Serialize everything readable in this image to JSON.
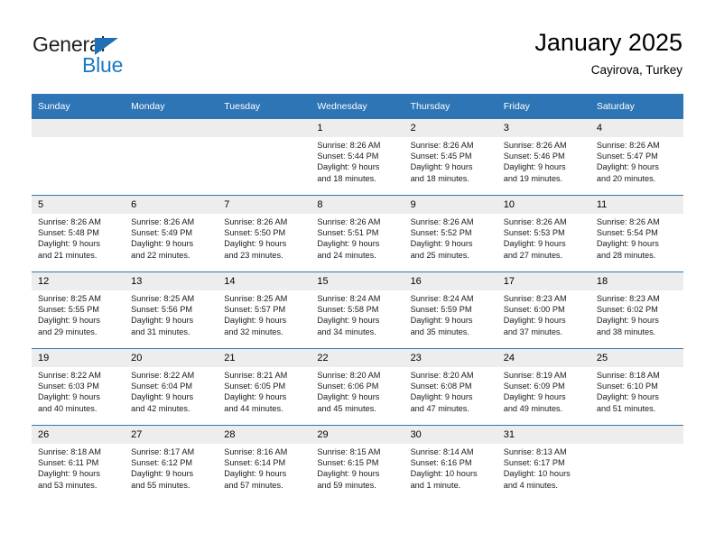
{
  "brand": {
    "name_top": "General",
    "name_bottom": "Blue",
    "triangle_color": "#1f6fb5",
    "blue_text_color": "#1a7ac4"
  },
  "header": {
    "month_title": "January 2025",
    "location": "Cayirova, Turkey"
  },
  "theme": {
    "header_blue": "#2e75b6",
    "daynum_band": "#ededed"
  },
  "weekday_headers": [
    "Sunday",
    "Monday",
    "Tuesday",
    "Wednesday",
    "Thursday",
    "Friday",
    "Saturday"
  ],
  "weeks": [
    [
      {
        "day": "",
        "blank": true,
        "sunrise": "",
        "sunset": "",
        "daylight1": "",
        "daylight2": ""
      },
      {
        "day": "",
        "blank": true,
        "sunrise": "",
        "sunset": "",
        "daylight1": "",
        "daylight2": ""
      },
      {
        "day": "",
        "blank": true,
        "sunrise": "",
        "sunset": "",
        "daylight1": "",
        "daylight2": ""
      },
      {
        "day": "1",
        "blank": false,
        "sunrise": "Sunrise: 8:26 AM",
        "sunset": "Sunset: 5:44 PM",
        "daylight1": "Daylight: 9 hours",
        "daylight2": "and 18 minutes."
      },
      {
        "day": "2",
        "blank": false,
        "sunrise": "Sunrise: 8:26 AM",
        "sunset": "Sunset: 5:45 PM",
        "daylight1": "Daylight: 9 hours",
        "daylight2": "and 18 minutes."
      },
      {
        "day": "3",
        "blank": false,
        "sunrise": "Sunrise: 8:26 AM",
        "sunset": "Sunset: 5:46 PM",
        "daylight1": "Daylight: 9 hours",
        "daylight2": "and 19 minutes."
      },
      {
        "day": "4",
        "blank": false,
        "sunrise": "Sunrise: 8:26 AM",
        "sunset": "Sunset: 5:47 PM",
        "daylight1": "Daylight: 9 hours",
        "daylight2": "and 20 minutes."
      }
    ],
    [
      {
        "day": "5",
        "blank": false,
        "sunrise": "Sunrise: 8:26 AM",
        "sunset": "Sunset: 5:48 PM",
        "daylight1": "Daylight: 9 hours",
        "daylight2": "and 21 minutes."
      },
      {
        "day": "6",
        "blank": false,
        "sunrise": "Sunrise: 8:26 AM",
        "sunset": "Sunset: 5:49 PM",
        "daylight1": "Daylight: 9 hours",
        "daylight2": "and 22 minutes."
      },
      {
        "day": "7",
        "blank": false,
        "sunrise": "Sunrise: 8:26 AM",
        "sunset": "Sunset: 5:50 PM",
        "daylight1": "Daylight: 9 hours",
        "daylight2": "and 23 minutes."
      },
      {
        "day": "8",
        "blank": false,
        "sunrise": "Sunrise: 8:26 AM",
        "sunset": "Sunset: 5:51 PM",
        "daylight1": "Daylight: 9 hours",
        "daylight2": "and 24 minutes."
      },
      {
        "day": "9",
        "blank": false,
        "sunrise": "Sunrise: 8:26 AM",
        "sunset": "Sunset: 5:52 PM",
        "daylight1": "Daylight: 9 hours",
        "daylight2": "and 25 minutes."
      },
      {
        "day": "10",
        "blank": false,
        "sunrise": "Sunrise: 8:26 AM",
        "sunset": "Sunset: 5:53 PM",
        "daylight1": "Daylight: 9 hours",
        "daylight2": "and 27 minutes."
      },
      {
        "day": "11",
        "blank": false,
        "sunrise": "Sunrise: 8:26 AM",
        "sunset": "Sunset: 5:54 PM",
        "daylight1": "Daylight: 9 hours",
        "daylight2": "and 28 minutes."
      }
    ],
    [
      {
        "day": "12",
        "blank": false,
        "sunrise": "Sunrise: 8:25 AM",
        "sunset": "Sunset: 5:55 PM",
        "daylight1": "Daylight: 9 hours",
        "daylight2": "and 29 minutes."
      },
      {
        "day": "13",
        "blank": false,
        "sunrise": "Sunrise: 8:25 AM",
        "sunset": "Sunset: 5:56 PM",
        "daylight1": "Daylight: 9 hours",
        "daylight2": "and 31 minutes."
      },
      {
        "day": "14",
        "blank": false,
        "sunrise": "Sunrise: 8:25 AM",
        "sunset": "Sunset: 5:57 PM",
        "daylight1": "Daylight: 9 hours",
        "daylight2": "and 32 minutes."
      },
      {
        "day": "15",
        "blank": false,
        "sunrise": "Sunrise: 8:24 AM",
        "sunset": "Sunset: 5:58 PM",
        "daylight1": "Daylight: 9 hours",
        "daylight2": "and 34 minutes."
      },
      {
        "day": "16",
        "blank": false,
        "sunrise": "Sunrise: 8:24 AM",
        "sunset": "Sunset: 5:59 PM",
        "daylight1": "Daylight: 9 hours",
        "daylight2": "and 35 minutes."
      },
      {
        "day": "17",
        "blank": false,
        "sunrise": "Sunrise: 8:23 AM",
        "sunset": "Sunset: 6:00 PM",
        "daylight1": "Daylight: 9 hours",
        "daylight2": "and 37 minutes."
      },
      {
        "day": "18",
        "blank": false,
        "sunrise": "Sunrise: 8:23 AM",
        "sunset": "Sunset: 6:02 PM",
        "daylight1": "Daylight: 9 hours",
        "daylight2": "and 38 minutes."
      }
    ],
    [
      {
        "day": "19",
        "blank": false,
        "sunrise": "Sunrise: 8:22 AM",
        "sunset": "Sunset: 6:03 PM",
        "daylight1": "Daylight: 9 hours",
        "daylight2": "and 40 minutes."
      },
      {
        "day": "20",
        "blank": false,
        "sunrise": "Sunrise: 8:22 AM",
        "sunset": "Sunset: 6:04 PM",
        "daylight1": "Daylight: 9 hours",
        "daylight2": "and 42 minutes."
      },
      {
        "day": "21",
        "blank": false,
        "sunrise": "Sunrise: 8:21 AM",
        "sunset": "Sunset: 6:05 PM",
        "daylight1": "Daylight: 9 hours",
        "daylight2": "and 44 minutes."
      },
      {
        "day": "22",
        "blank": false,
        "sunrise": "Sunrise: 8:20 AM",
        "sunset": "Sunset: 6:06 PM",
        "daylight1": "Daylight: 9 hours",
        "daylight2": "and 45 minutes."
      },
      {
        "day": "23",
        "blank": false,
        "sunrise": "Sunrise: 8:20 AM",
        "sunset": "Sunset: 6:08 PM",
        "daylight1": "Daylight: 9 hours",
        "daylight2": "and 47 minutes."
      },
      {
        "day": "24",
        "blank": false,
        "sunrise": "Sunrise: 8:19 AM",
        "sunset": "Sunset: 6:09 PM",
        "daylight1": "Daylight: 9 hours",
        "daylight2": "and 49 minutes."
      },
      {
        "day": "25",
        "blank": false,
        "sunrise": "Sunrise: 8:18 AM",
        "sunset": "Sunset: 6:10 PM",
        "daylight1": "Daylight: 9 hours",
        "daylight2": "and 51 minutes."
      }
    ],
    [
      {
        "day": "26",
        "blank": false,
        "sunrise": "Sunrise: 8:18 AM",
        "sunset": "Sunset: 6:11 PM",
        "daylight1": "Daylight: 9 hours",
        "daylight2": "and 53 minutes."
      },
      {
        "day": "27",
        "blank": false,
        "sunrise": "Sunrise: 8:17 AM",
        "sunset": "Sunset: 6:12 PM",
        "daylight1": "Daylight: 9 hours",
        "daylight2": "and 55 minutes."
      },
      {
        "day": "28",
        "blank": false,
        "sunrise": "Sunrise: 8:16 AM",
        "sunset": "Sunset: 6:14 PM",
        "daylight1": "Daylight: 9 hours",
        "daylight2": "and 57 minutes."
      },
      {
        "day": "29",
        "blank": false,
        "sunrise": "Sunrise: 8:15 AM",
        "sunset": "Sunset: 6:15 PM",
        "daylight1": "Daylight: 9 hours",
        "daylight2": "and 59 minutes."
      },
      {
        "day": "30",
        "blank": false,
        "sunrise": "Sunrise: 8:14 AM",
        "sunset": "Sunset: 6:16 PM",
        "daylight1": "Daylight: 10 hours",
        "daylight2": "and 1 minute."
      },
      {
        "day": "31",
        "blank": false,
        "sunrise": "Sunrise: 8:13 AM",
        "sunset": "Sunset: 6:17 PM",
        "daylight1": "Daylight: 10 hours",
        "daylight2": "and 4 minutes."
      },
      {
        "day": "",
        "blank": true,
        "sunrise": "",
        "sunset": "",
        "daylight1": "",
        "daylight2": ""
      }
    ]
  ]
}
